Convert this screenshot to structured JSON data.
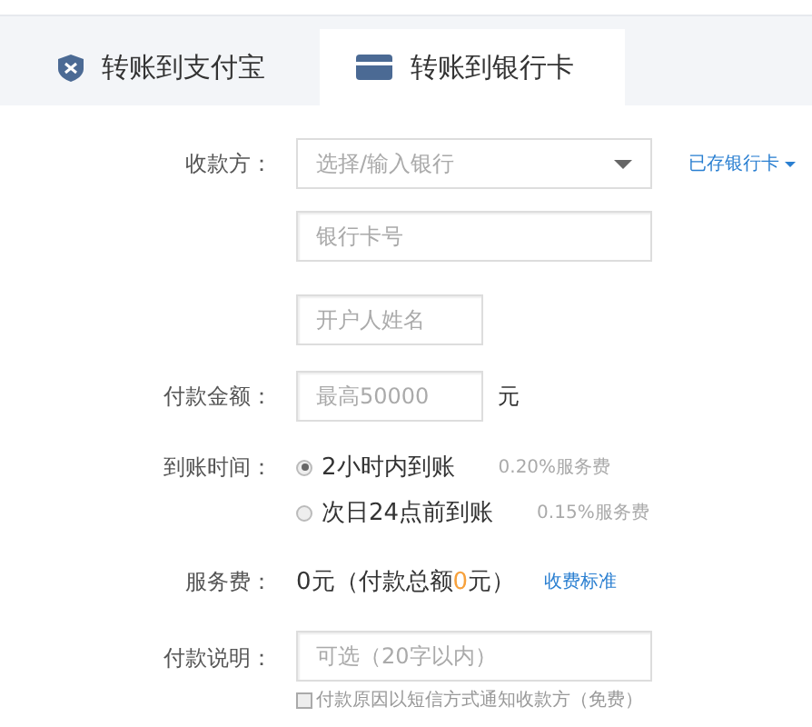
{
  "tabs": [
    {
      "label": "转账到支付宝",
      "selected": false
    },
    {
      "label": "转账到银行卡",
      "selected": true
    }
  ],
  "recipient": {
    "label": "收款方：",
    "bank_placeholder": "选择/输入银行",
    "saved_cards_link": "已存银行卡"
  },
  "card_number": {
    "placeholder": "银行卡号"
  },
  "account_name": {
    "placeholder": "开户人姓名"
  },
  "amount": {
    "label": "付款金额：",
    "placeholder": "最高50000",
    "unit": "元"
  },
  "arrival": {
    "label": "到账时间：",
    "options": [
      {
        "label": "2小时内到账",
        "fee": "0.20%服务费",
        "selected": true
      },
      {
        "label": "次日24点前到账",
        "fee": "0.15%服务费",
        "selected": false
      }
    ]
  },
  "service_fee": {
    "label": "服务费：",
    "text_before": "0元（付款总额",
    "total": "0",
    "text_after": "元）",
    "link": "收费标准"
  },
  "note": {
    "label": "付款说明：",
    "placeholder": "可选（20字以内）",
    "sms_notice": {
      "label": "付款原因以短信方式通知收款方（免费）",
      "checked": false
    }
  }
}
